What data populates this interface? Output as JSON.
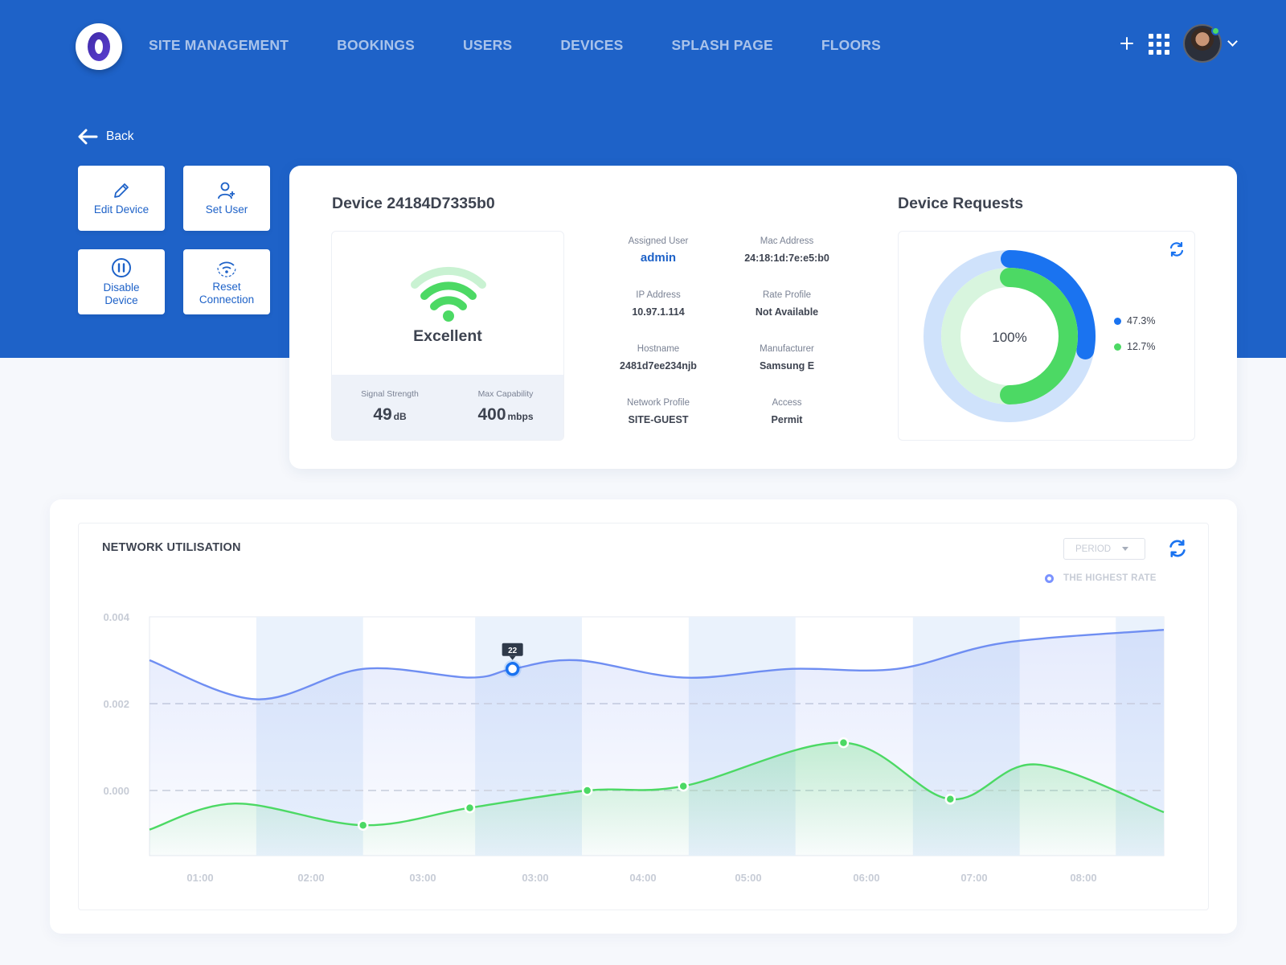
{
  "nav": {
    "items": [
      "SITE MANAGEMENT",
      "BOOKINGS",
      "USERS",
      "DEVICES",
      "SPLASH PAGE",
      "FLOORS"
    ],
    "actions": [
      "plus-icon",
      "apps-grid-icon",
      "avatar",
      "chevron-down-icon"
    ]
  },
  "back_label": "Back",
  "actions": {
    "edit": "Edit Device",
    "set_user": "Set User",
    "disable": "Disable Device",
    "reset": "Reset Connection"
  },
  "device": {
    "title": "Device 24184D7335b0",
    "signal_quality": "Excellent",
    "signal_strength_label": "Signal Strength",
    "signal_strength_value": "49",
    "signal_strength_unit": "dB",
    "max_capability_label": "Max Capability",
    "max_capability_value": "400",
    "max_capability_unit": "mbps",
    "info": [
      {
        "label": "Assigned User",
        "value": "admin"
      },
      {
        "label": "Mac Address",
        "value": "24:18:1d:7e:e5:b0"
      },
      {
        "label": "IP Address",
        "value": "10.97.1.114"
      },
      {
        "label": "Rate Profile",
        "value": "Not Available"
      },
      {
        "label": "Hostname",
        "value": "2481d7ee234njb"
      },
      {
        "label": "Manufacturer",
        "value": "Samsung E"
      },
      {
        "label": "Network Profile",
        "value": "SITE-GUEST"
      },
      {
        "label": "Access",
        "value": "Permit"
      }
    ]
  },
  "requests": {
    "title": "Device Requests",
    "center_label": "100%",
    "series": [
      {
        "label": "47.3%",
        "value": 47.3,
        "color": "#1a73f0"
      },
      {
        "label": "12.7%",
        "value": 12.7,
        "color": "#4cd964"
      }
    ]
  },
  "network": {
    "title": "NETWORK UTILISATION",
    "period_label": "PERIOD",
    "legend_label": "THE HIGHEST RATE",
    "tooltip": "22"
  },
  "colors": {
    "primary": "#1e62c8",
    "accent_blue": "#1a73f0",
    "line_blue": "#6f8ef2",
    "green": "#4cd964"
  },
  "chart_data": {
    "type": "line",
    "y_ticks": [
      "0.004",
      "0.002",
      "0.000"
    ],
    "ylim": [
      -0.0015,
      0.004
    ],
    "x_ticks": [
      "01:00",
      "02:00",
      "03:00",
      "03:00",
      "04:00",
      "05:00",
      "06:00",
      "07:00",
      "08:00"
    ],
    "series": [
      {
        "color": "#6f8ef2",
        "x": [
          0,
          1.0,
          2.0,
          3.0,
          3.4,
          4.0,
          5.0,
          6.0,
          7.0,
          8.0,
          9.5
        ],
        "values": [
          0.003,
          0.0021,
          0.0028,
          0.0026,
          0.0028,
          0.003,
          0.0026,
          0.0028,
          0.0028,
          0.0034,
          0.0037
        ]
      },
      {
        "color": "#4cd964",
        "x": [
          0,
          0.8,
          2.0,
          3.0,
          4.1,
          5.0,
          6.5,
          7.5,
          8.3,
          9.5
        ],
        "values": [
          -0.0009,
          -0.0003,
          -0.0008,
          -0.0004,
          0.0,
          0.0001,
          0.0011,
          -0.0002,
          0.0006,
          -0.0005
        ],
        "markers": [
          2,
          3,
          4,
          5,
          6,
          7
        ]
      }
    ],
    "highlight_point": {
      "series": 0,
      "index": 4,
      "label": "22"
    }
  }
}
